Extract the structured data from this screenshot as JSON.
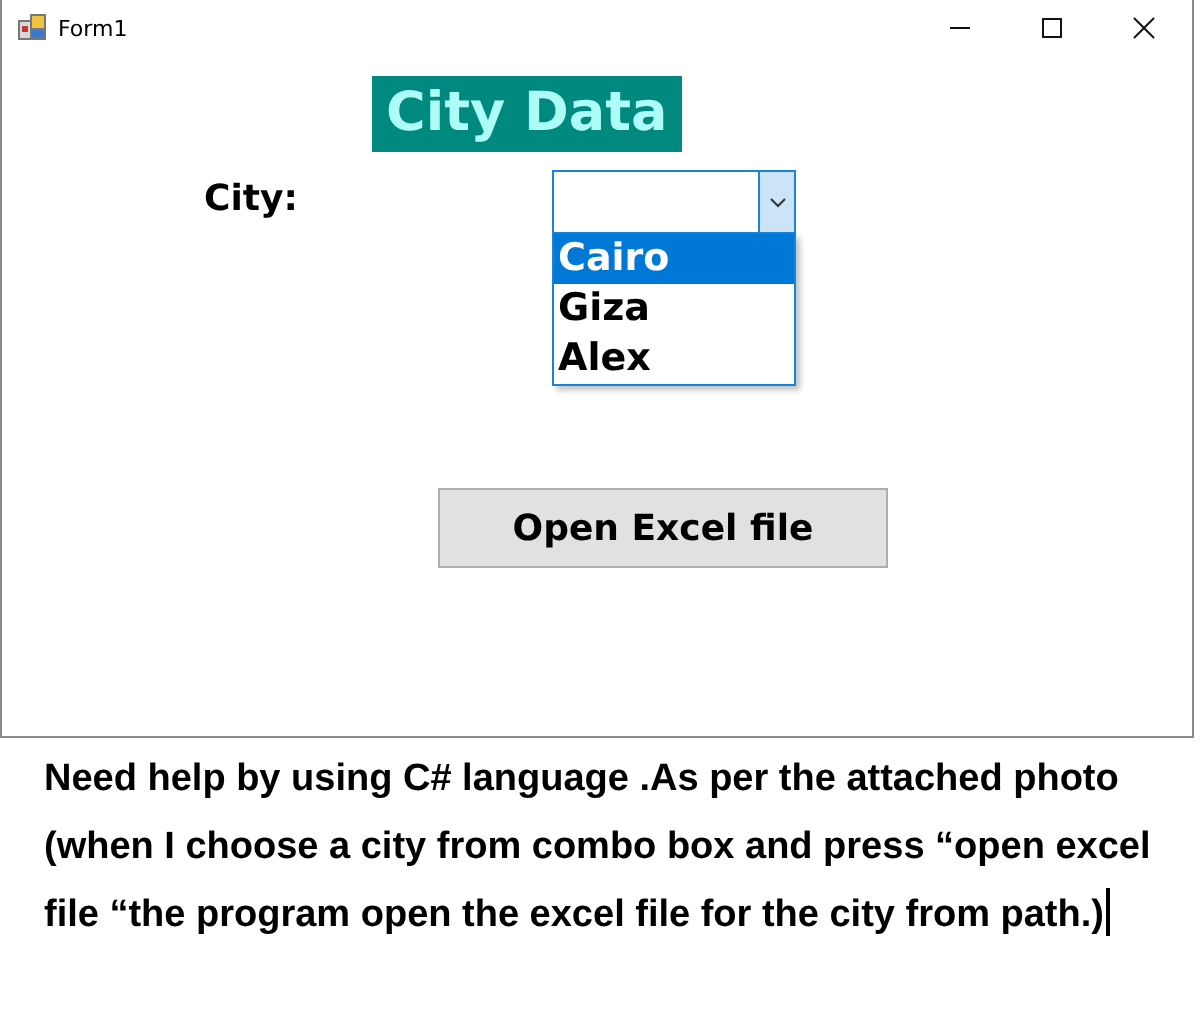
{
  "window": {
    "title": "Form1"
  },
  "form": {
    "heading": "City Data",
    "city_label": "City:",
    "combo": {
      "expanded": true,
      "options": [
        {
          "label": "Cairo",
          "selected": true
        },
        {
          "label": "Giza",
          "selected": false
        },
        {
          "label": "Alex",
          "selected": false
        }
      ]
    },
    "button": "Open Excel file"
  },
  "question": {
    "text": "Need help by using C# language .As per the attached photo (when I choose a city from combo box and press “open excel file “the program open the excel file for the city from path.)",
    "caret": true
  }
}
